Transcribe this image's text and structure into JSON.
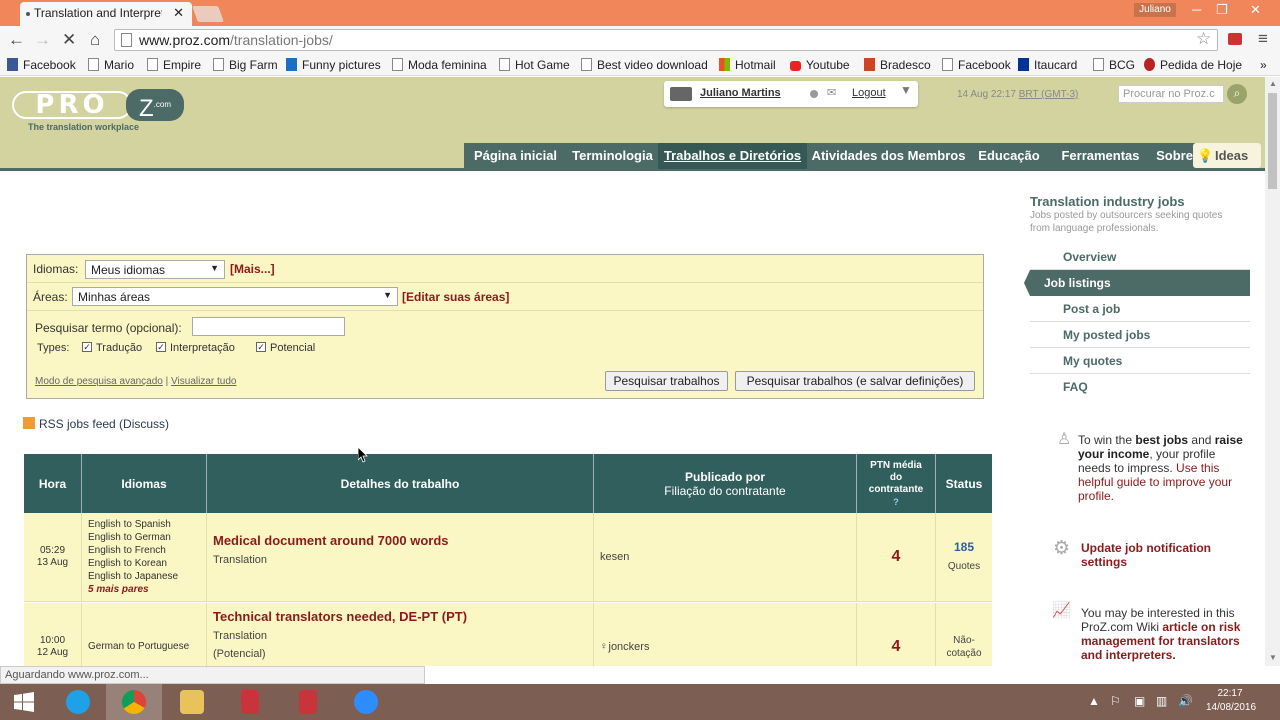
{
  "browser": {
    "tab_title": "Translation and Interpreti",
    "profile_name": "Juliano",
    "url_host": "www.proz.com",
    "url_path": "/translation-jobs/",
    "status_text": "Aguardando www.proz.com...",
    "bookmarks": [
      "Facebook",
      "Mario",
      "Empire",
      "Big Farm",
      "Funny pictures",
      "Moda feminina",
      "Hot Game",
      "Best video download",
      "Hotmail",
      "Youtube",
      "Bradesco",
      "Facebook",
      "Itaucard",
      "BCG",
      "Pedida de Hoje"
    ]
  },
  "header": {
    "logo_left": "PRO",
    "logo_right": "Z",
    "logo_suffix": ".com",
    "tagline": "The translation workplace",
    "user_name": "Juliano Martins",
    "logout": "Logout",
    "datetime": "14 Aug 22:17",
    "timezone": "BRT (GMT-3)",
    "search_placeholder": "Procurar no Proz.c",
    "nav": [
      "Página inicial",
      "Terminologia",
      "Trabalhos e Diretórios",
      "Atividades dos Membros",
      "Educação",
      "Ferramentas",
      "Sobre"
    ],
    "ideas": "Ideas"
  },
  "search": {
    "idiomas_label": "Idiomas:",
    "idiomas_value": "Meus idiomas",
    "more_link": "[Mais...]",
    "areas_label": "Áreas:",
    "areas_value": "Minhas áreas",
    "edit_areas": "[Editar suas áreas]",
    "term_label": "Pesquisar termo (opcional):",
    "types_label": "Types:",
    "types": [
      "Tradução",
      "Interpretação",
      "Potencial"
    ],
    "advanced_link": "Modo de pesquisa avançado",
    "separator": "|",
    "view_all": "Visualizar tudo",
    "search_btn": "Pesquisar trabalhos",
    "search_save_btn": "Pesquisar trabalhos  (e salvar definições)"
  },
  "rss": "RSS jobs feed (Discuss)",
  "table": {
    "headers": {
      "hora": "Hora",
      "idiomas": "Idiomas",
      "detalhes": "Detalhes do trabalho",
      "publicado": "Publicado por",
      "filiacao": "Filiação do contratante",
      "ptn1": "PTN média",
      "ptn2": "do",
      "ptn3": "contratante",
      "ptn_q": "?",
      "status": "Status"
    },
    "rows": [
      {
        "time": "05:29",
        "date": "13 Aug",
        "langs": [
          "English to Spanish",
          "English to German",
          "English to French",
          "English to Korean",
          "English to Japanese"
        ],
        "more": "5 mais pares",
        "title": "Medical document around 7000 words",
        "type": "Translation",
        "extra": "",
        "poster": "kesen",
        "ptn": "4",
        "status_num": "185",
        "status_text": "Quotes"
      },
      {
        "time": "10:00",
        "date": "12 Aug",
        "langs": [
          "German to Portuguese"
        ],
        "more": "",
        "title": "Technical translators needed, DE-PT (PT)",
        "type": "Translation",
        "extra": "(Potencial)",
        "poster": "jonckers",
        "ptn": "4",
        "status_num": "",
        "status_text": "Não-cotação"
      }
    ]
  },
  "sidebar": {
    "title": "Translation industry jobs",
    "subtitle": "Jobs posted by outsourcers seeking quotes from language professionals.",
    "items": [
      "Overview",
      "Job listings",
      "Post a job",
      "My posted jobs",
      "My quotes",
      "FAQ"
    ],
    "promo_pre": "To win the ",
    "promo_b1": "best jobs",
    "promo_mid": " and ",
    "promo_b2": "raise your income",
    "promo_post": ", your profile needs to impress. ",
    "promo_link": "Use this helpful guide to improve your profile.",
    "notif_link": "Update job notification settings",
    "wiki_pre": "You may be interested in this ProZ.com Wiki ",
    "wiki_link": "article on risk management for translators and interpreters."
  },
  "taskbar": {
    "time": "22:17",
    "date": "14/08/2016"
  },
  "colors": {
    "header_bg": "#d2d39f",
    "nav_bg": "#4c6a66",
    "table_head": "#315f5d",
    "row_bg": "#fbf7c4",
    "accent_red": "#8b1a1a",
    "taskbar": "#7c5e52"
  }
}
